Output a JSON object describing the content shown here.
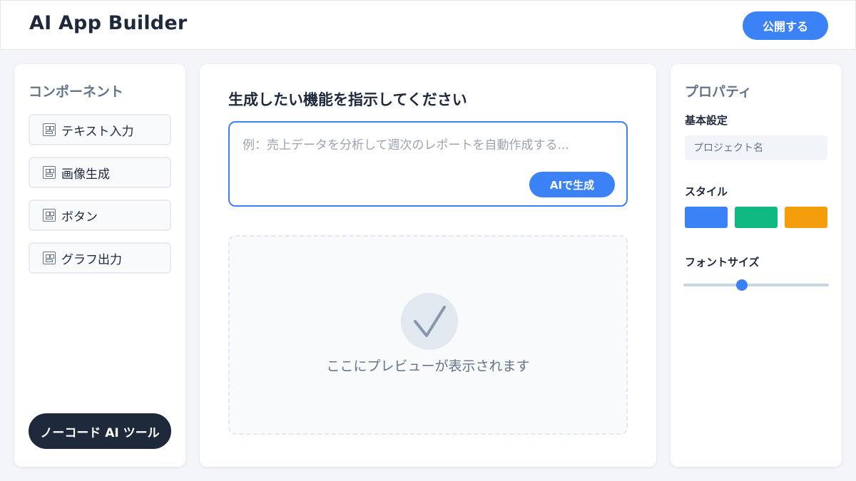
{
  "header": {
    "title": "AI App Builder",
    "publish_label": "公開する"
  },
  "components": {
    "heading": "コンポーネント",
    "items": [
      {
        "label": "テキスト入力",
        "icon": "component-icon"
      },
      {
        "label": "画像生成",
        "icon": "component-icon"
      },
      {
        "label": "ボタン",
        "icon": "component-icon"
      },
      {
        "label": "グラフ出力",
        "icon": "component-icon"
      }
    ],
    "badge": "ノーコード AI ツール"
  },
  "editor": {
    "heading": "生成したい機能を指示してください",
    "input_value": "",
    "input_placeholder": "例：売上データを分析して週次のレポートを自動作成する...",
    "generate_label": "AIで生成",
    "preview_text": "ここにプレビューが表示されます",
    "preview_icon": "checkmark-icon"
  },
  "properties": {
    "heading": "プロパティ",
    "basic_label": "基本設定",
    "project_name_value": "",
    "project_name_placeholder": "プロジェクト名",
    "style_label": "スタイル",
    "swatches": [
      "#3b82f6",
      "#10b981",
      "#f59e0b"
    ],
    "font_size_label": "フォントサイズ",
    "font_size_fraction": 0.4
  },
  "colors": {
    "accent": "#3b82f6",
    "dark": "#1e293b",
    "muted": "#64748b"
  }
}
